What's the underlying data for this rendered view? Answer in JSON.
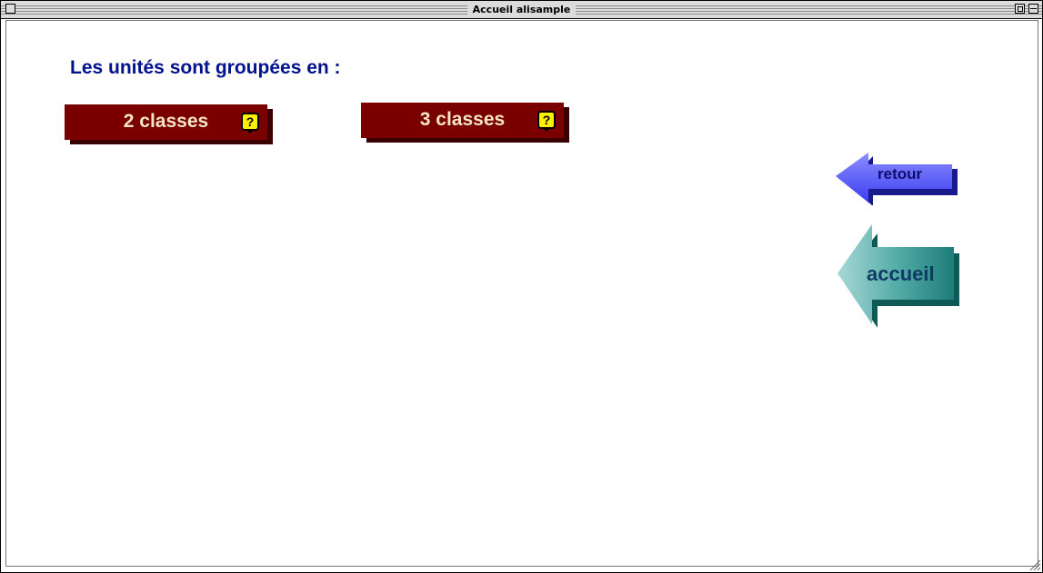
{
  "window": {
    "title": "Accueil alisample"
  },
  "main": {
    "heading": "Les unités sont groupées en :",
    "buttons": [
      {
        "label": "2 classes",
        "help": "?"
      },
      {
        "label": "3 classes",
        "help": "?"
      }
    ]
  },
  "nav": {
    "back_label": "retour",
    "home_label": "accueil"
  },
  "colors": {
    "heading": "#00128c",
    "button_bg": "#7a0000",
    "button_text": "#f7e6c5",
    "help_icon": "#ffee00",
    "back_arrow": "#5a5cff",
    "home_arrow": "#2a8a86"
  }
}
